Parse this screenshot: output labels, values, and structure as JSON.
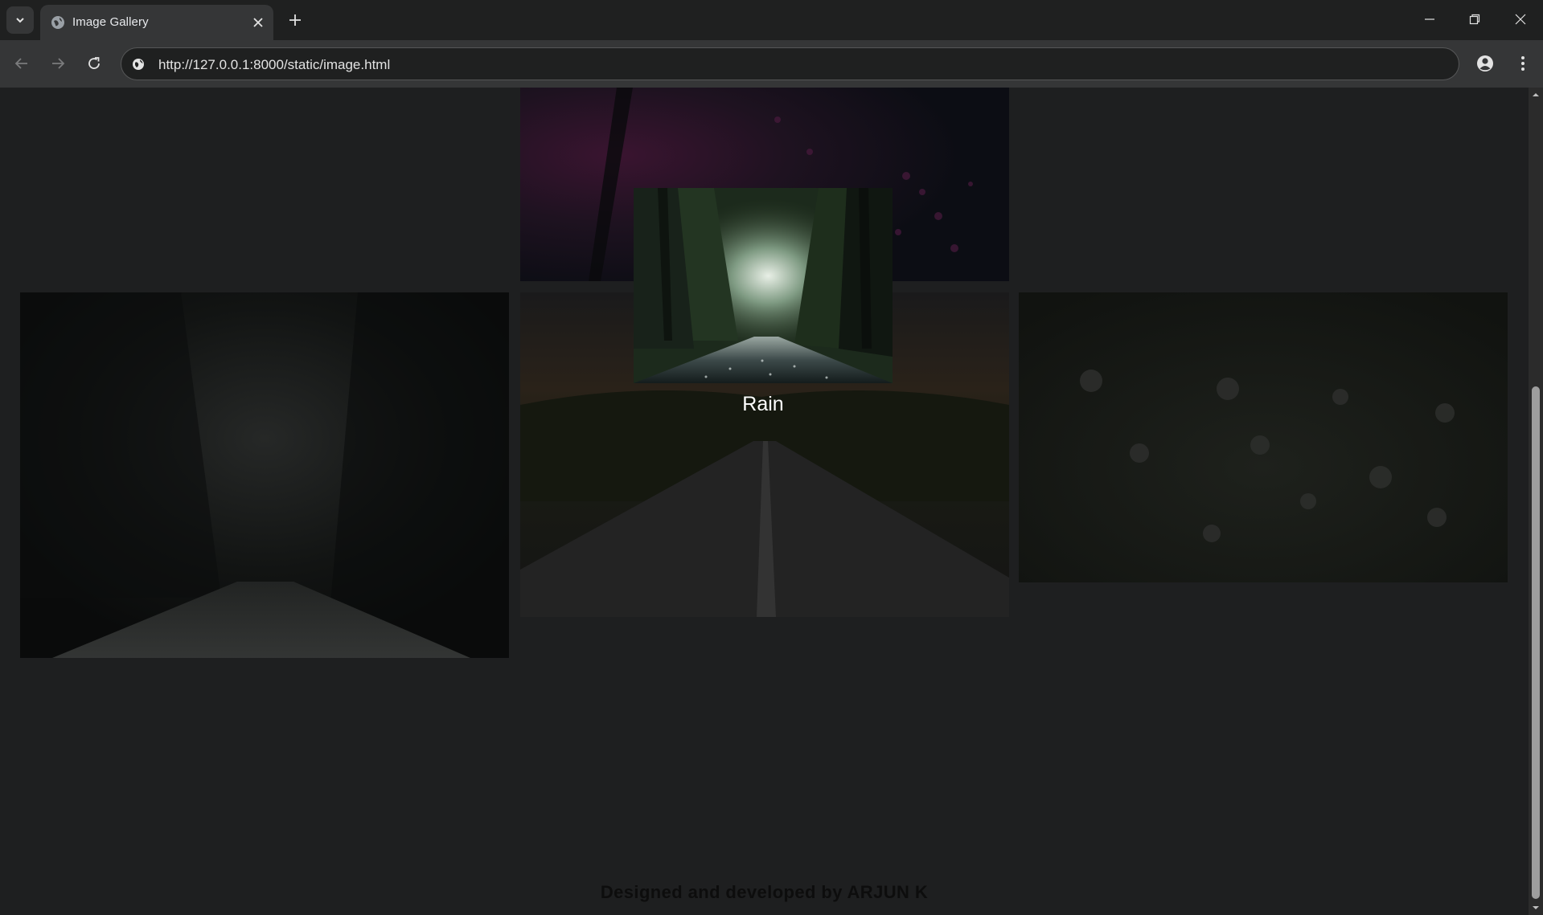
{
  "browser": {
    "tab_title": "Image Gallery",
    "url": "http://127.0.0.1:8000/static/image.html",
    "icons": [
      "tab-search-icon",
      "globe-icon",
      "close-icon",
      "plus-icon",
      "minimize-icon",
      "restore-icon",
      "close-window-icon",
      "back-arrow-icon",
      "forward-arrow-icon",
      "reload-icon",
      "site-info-icon",
      "profile-icon",
      "kebab-menu-icon"
    ]
  },
  "gallery": {
    "featured_caption": "Rain",
    "footer": "Designed and developed by ARJUN K"
  },
  "colors": {
    "page_background": "#1e1f20",
    "chrome_dark": "#1f2020",
    "chrome_light": "#353637",
    "caption_text": "#ffffff"
  }
}
